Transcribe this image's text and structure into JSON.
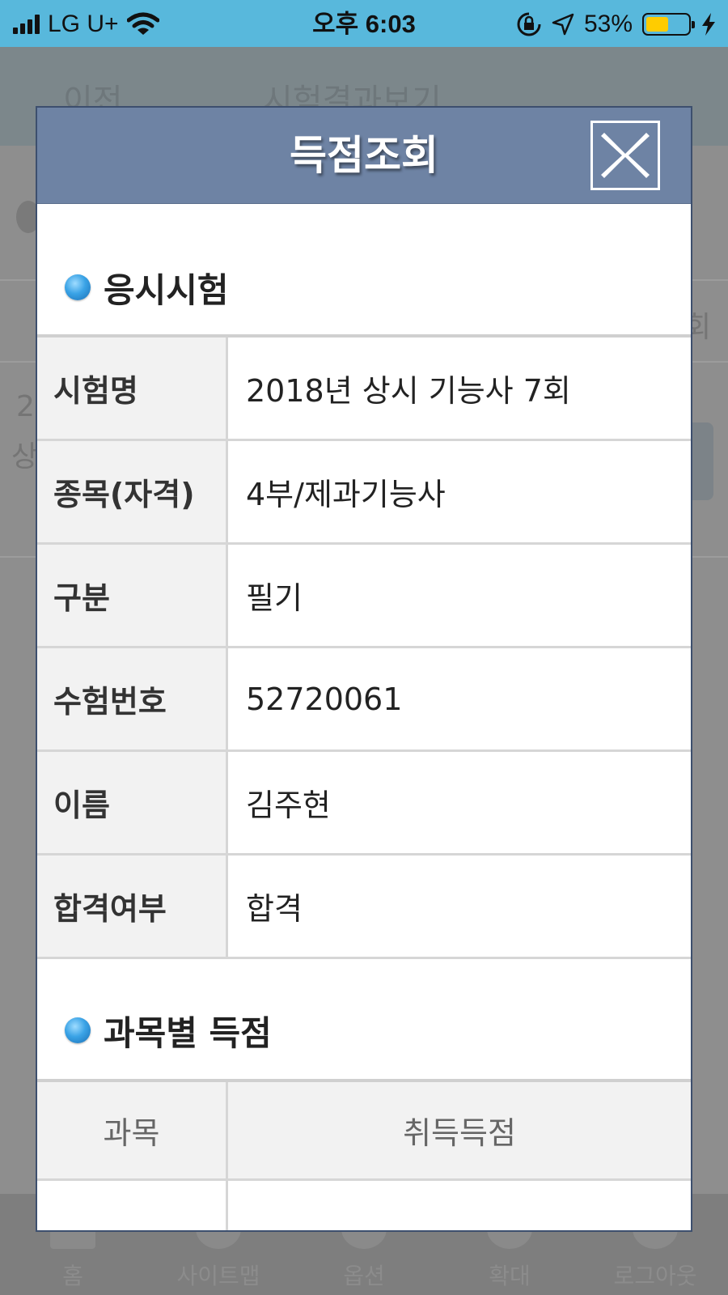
{
  "status_bar": {
    "carrier": "LG U+",
    "time": "오후 6:03",
    "battery_percent": "53%",
    "battery_level": 0.53,
    "battery_color": "#ffcc00",
    "bar_color": "#58b8dc"
  },
  "background_page": {
    "back_label": "이전",
    "title": "시험결과보기",
    "partial_texts": [
      "2",
      "상",
      "회"
    ],
    "bottom_nav": [
      {
        "label": "홈",
        "icon": "home-icon"
      },
      {
        "label": "사이트맵",
        "icon": "sitemap-icon"
      },
      {
        "label": "옵션",
        "icon": "gear-icon"
      },
      {
        "label": "확대",
        "icon": "zoom-in-icon"
      },
      {
        "label": "로그아웃",
        "icon": "logout-icon"
      }
    ]
  },
  "modal": {
    "title": "득점조회",
    "header_color": "#6e83a4",
    "close_icon": "close-icon",
    "section_exam": "응시시험",
    "info_rows": [
      {
        "label": "시험명",
        "value": "2018년 상시 기능사 7회"
      },
      {
        "label": "종목(자격)",
        "value": "4부/제과기능사"
      },
      {
        "label": "구분",
        "value": "필기"
      },
      {
        "label": "수험번호",
        "value": "52720061"
      },
      {
        "label": "이름",
        "value": "김주현"
      },
      {
        "label": "합격여부",
        "value": "합격"
      }
    ],
    "section_scores": "과목별 득점",
    "score_headers": {
      "subject": "과목",
      "score": "취득득점"
    }
  }
}
